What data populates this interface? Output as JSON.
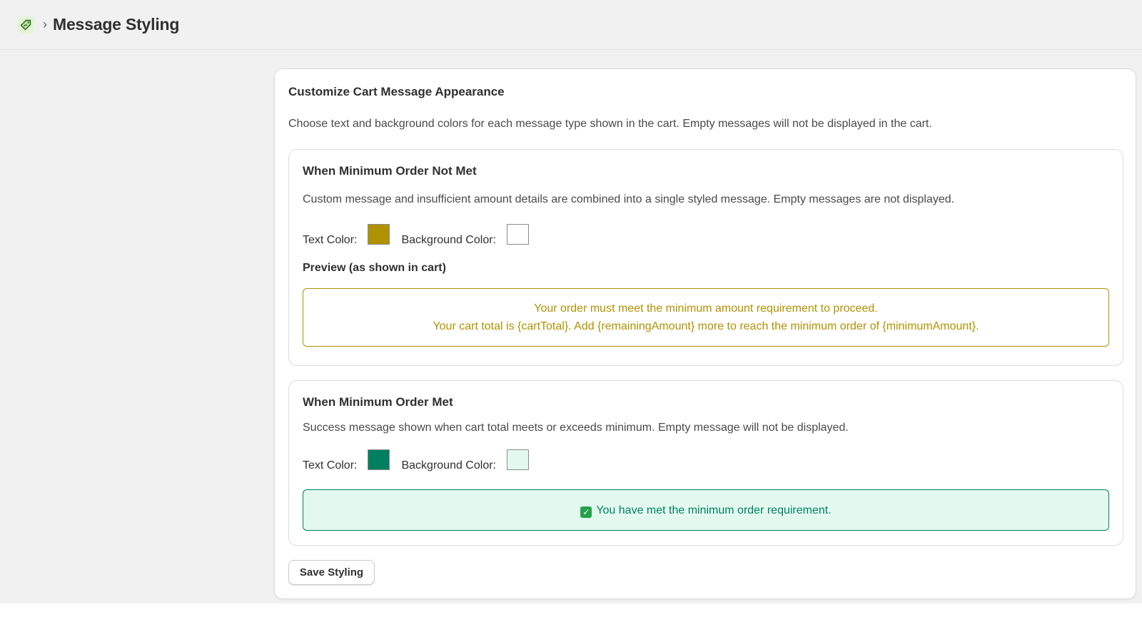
{
  "header": {
    "app_icon": "price-tag-icon",
    "separator": "›",
    "title": "Message Styling"
  },
  "card": {
    "title": "Customize Cart Message Appearance",
    "description": "Choose text and background colors for each message type shown in the cart. Empty messages will not be displayed in the cart."
  },
  "not_met": {
    "title": "When Minimum Order Not Met",
    "description": "Custom message and insufficient amount details are combined into a single styled message. Empty messages are not displayed.",
    "text_color_label": "Text Color:",
    "text_color": "#b09200",
    "bg_color_label": "Background Color:",
    "bg_color": "#ffffff",
    "preview_label": "Preview (as shown in cart)",
    "preview_line1": "Your order must meet the minimum amount requirement to proceed.",
    "preview_line2": "Your cart total is {cartTotal}. Add {remainingAmount} more to reach the minimum order of {minimumAmount}."
  },
  "met": {
    "title": "When Minimum Order Met",
    "description": "Success message shown when cart total meets or exceeds minimum. Empty message will not be displayed.",
    "text_color_label": "Text Color:",
    "text_color": "#008060",
    "bg_color_label": "Background Color:",
    "bg_color": "#e3f9ef",
    "preview_icon": "check-mark-icon",
    "preview_text": "You have met the minimum order requirement."
  },
  "actions": {
    "save_label": "Save Styling"
  }
}
